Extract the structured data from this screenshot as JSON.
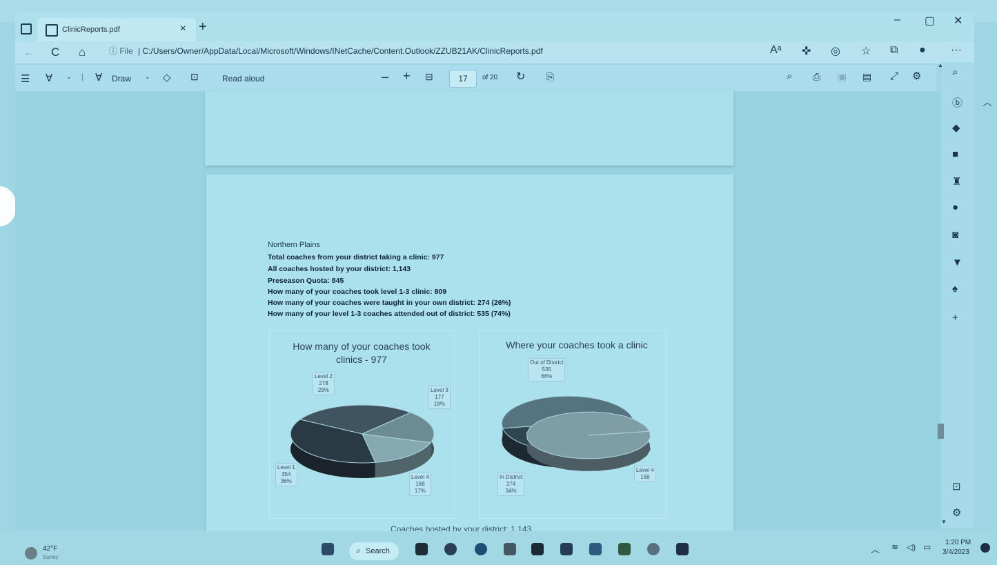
{
  "tab": {
    "title": "ClinicReports.pdf",
    "close": "×"
  },
  "newtab": "+",
  "window": {
    "minimize": "–",
    "maximize": "▢",
    "close": "✕"
  },
  "address": {
    "info": "ⓘ File",
    "sep": "|",
    "url": "C:/Users/Owner/AppData/Local/Microsoft/Windows/INetCache/Content.Outlook/ZZUB21AK/ClinicReports.pdf"
  },
  "nav": {
    "refresh_icon": "C",
    "home_icon": "⌂"
  },
  "toolbar": {
    "draw_label": "Draw",
    "read_aloud_label": "Read aloud",
    "zoom_out": "–",
    "zoom_in": "+",
    "page_current": "17",
    "page_total": "of 20"
  },
  "report": {
    "heading": "Northern Plains",
    "stats": [
      "Total coaches from your district taking a clinic: 977",
      "All coaches hosted by your district: 1,143",
      "Preseason Quota: 845",
      "How many of your coaches took level 1-3 clinic: 809",
      "How many of your coaches were taught in your own district: 274 (26%)",
      "How many of your level 1-3 coaches attended out of district: 535 (74%)"
    ],
    "footer_partial": "Coaches hosted by your district: 1,143"
  },
  "chart_data": [
    {
      "type": "pie",
      "title": "How many of your coaches took clinics - 977",
      "categories": [
        "Level 1",
        "Level 2",
        "Level 3",
        "Level 4"
      ],
      "values": [
        354,
        278,
        177,
        168
      ],
      "labels": [
        {
          "name": "Level 1",
          "value": "354",
          "pct": "36%"
        },
        {
          "name": "Level 2",
          "value": "278",
          "pct": "29%"
        },
        {
          "name": "Level 3",
          "value": "177",
          "pct": "18%"
        },
        {
          "name": "Level 4",
          "value": "168",
          "pct": "17%"
        }
      ],
      "colors": [
        "#2a3a44",
        "#3f5460",
        "#6d8b93",
        "#86a8b0"
      ]
    },
    {
      "type": "pie",
      "title": "Where your coaches took a clinic",
      "categories": [
        "Out of District",
        "In District",
        "Level 4"
      ],
      "values": [
        535,
        274,
        168
      ],
      "labels": [
        {
          "name": "Out of District",
          "value": "535",
          "pct": "66%"
        },
        {
          "name": "In District",
          "value": "274",
          "pct": "34%"
        },
        {
          "name": "Level 4",
          "value": "168",
          "pct": ""
        }
      ],
      "colors": [
        "#55747f",
        "#2f4550",
        "#7f9da5"
      ]
    }
  ],
  "taskbar": {
    "weather_temp": "42°F",
    "weather_desc": "Sunny",
    "search_label": "Search",
    "time": "1:20 PM",
    "date": "3/4/2023"
  }
}
